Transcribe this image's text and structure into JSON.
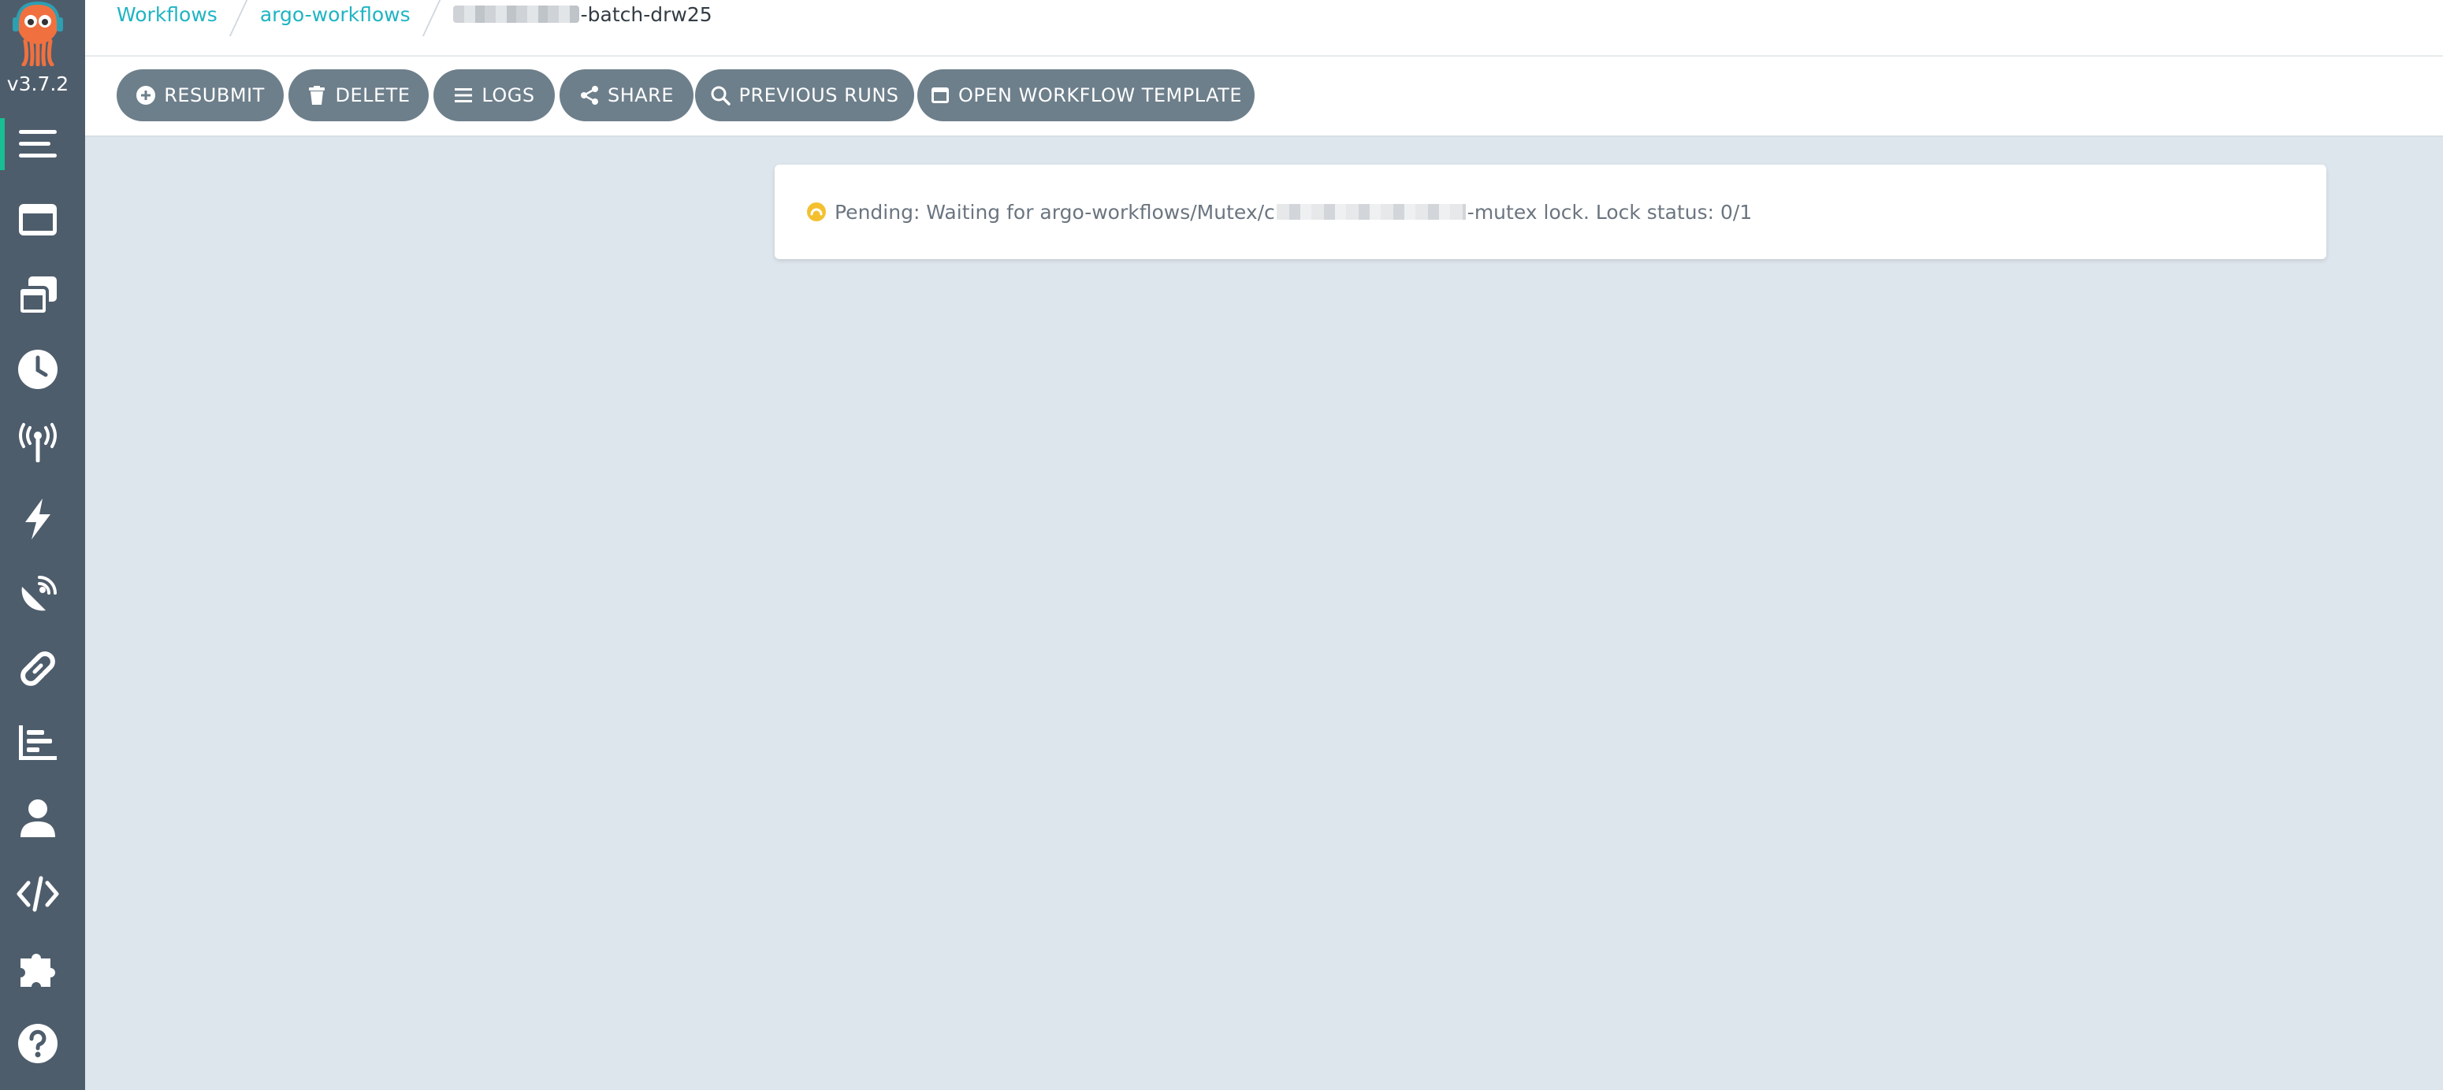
{
  "app": {
    "version": "v3.7.2"
  },
  "sidebar": {
    "items": [
      {
        "icon": "bars-icon",
        "active": true
      },
      {
        "icon": "window-icon"
      },
      {
        "icon": "clone-icon"
      },
      {
        "icon": "clock-icon"
      },
      {
        "icon": "broadcast-tower-icon"
      },
      {
        "icon": "bolt-icon"
      },
      {
        "icon": "satellite-dish-icon"
      },
      {
        "icon": "link-icon"
      },
      {
        "icon": "chart-bar-icon"
      },
      {
        "icon": "user-icon"
      },
      {
        "icon": "code-icon"
      },
      {
        "icon": "puzzle-piece-icon"
      },
      {
        "icon": "question-circle-icon"
      }
    ]
  },
  "breadcrumb": {
    "items": [
      "Workflows",
      "argo-workflows"
    ],
    "current_suffix": "-batch-drw25"
  },
  "toolbar": {
    "resubmit": "RESUBMIT",
    "delete": "DELETE",
    "logs": "LOGS",
    "share": "SHARE",
    "previous_runs": "PREVIOUS RUNS",
    "open_template": "OPEN WORKFLOW TEMPLATE"
  },
  "message": {
    "prefix": "Pending: Waiting for argo-workflows/Mutex/c",
    "suffix": "-mutex lock. Lock status: 0/1"
  },
  "colors": {
    "sidebar": "#4e5d6c",
    "accent": "#18be94",
    "link": "#1fb4c3",
    "button": "#6d7f8b",
    "pending": "#f4c030",
    "background": "#dee6ed"
  }
}
